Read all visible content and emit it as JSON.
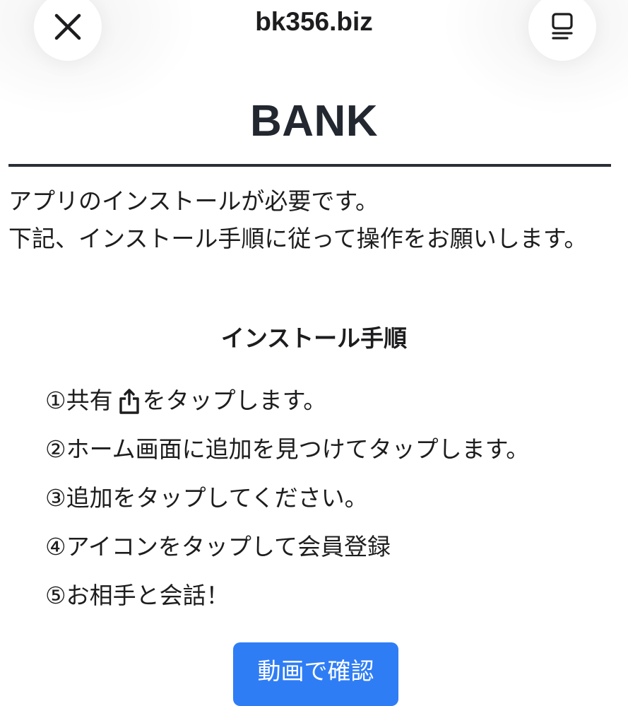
{
  "header": {
    "domain": "bk356.biz",
    "close_icon": "close-icon",
    "menu_icon": "tabs-overview-icon"
  },
  "brand": {
    "title": "BANK"
  },
  "intro": {
    "line1": "アプリのインストールが必要です。",
    "line2": "下記、インストール手順に従って操作をお願いします。"
  },
  "instructions": {
    "heading": "インストール手順",
    "steps": [
      {
        "prefix": "①共有",
        "icon": "share-icon",
        "suffix": "をタップします。"
      },
      {
        "text": "②ホーム画面に追加を見つけてタップします。"
      },
      {
        "text": "③追加をタップしてください。"
      },
      {
        "text": "④アイコンをタップして会員登録"
      },
      {
        "text": "⑤お相手と会話！"
      }
    ]
  },
  "video_button": {
    "label": "動画で確認"
  },
  "colors": {
    "accent": "#2f7df5",
    "text": "#1d1d1f",
    "divider": "#2b2f36"
  }
}
